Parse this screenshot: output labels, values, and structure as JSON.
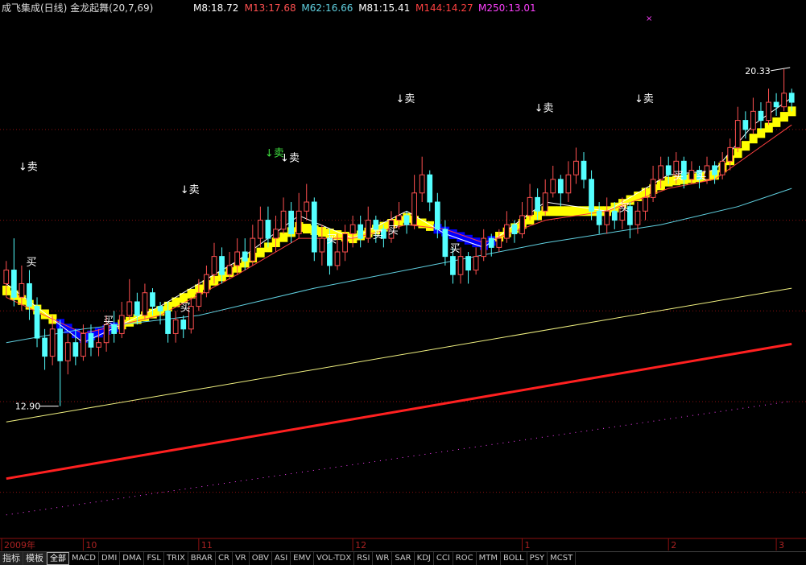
{
  "header": {
    "title": "成飞集成(日线) 金龙起舞(20,7,69)",
    "title_color": "#dddddd",
    "ma_labels": [
      {
        "text": "M8:18.72",
        "color": "#ffffff"
      },
      {
        "text": "M13:17.68",
        "color": "#ff5050"
      },
      {
        "text": "M62:16.66",
        "color": "#60d0e0"
      },
      {
        "text": "M81:15.41",
        "color": "#ffffff"
      },
      {
        "text": "M144:14.27",
        "color": "#ff4040"
      },
      {
        "text": "M250:13.01",
        "color": "#ff40ff"
      }
    ]
  },
  "chart_data": {
    "type": "candlestick",
    "x_labels": [
      {
        "text": "2009年",
        "index": 0
      },
      {
        "text": "10",
        "index": 10
      },
      {
        "text": "11",
        "index": 25
      },
      {
        "text": "12",
        "index": 45
      },
      {
        "text": "1",
        "index": 67
      },
      {
        "text": "2",
        "index": 86
      },
      {
        "text": "3",
        "index": 100
      }
    ],
    "ylim": [
      10.0,
      21.5
    ],
    "gridlines": [
      11.0,
      13.0,
      15.0,
      17.0,
      19.0
    ],
    "annotations": {
      "high": {
        "text": "20.33",
        "index": 102,
        "value": 20.33
      },
      "low": {
        "text": "12.90",
        "index": 7,
        "value": 12.9
      }
    },
    "candles": [
      [
        15.6,
        15.9,
        16.1,
        15.3
      ],
      [
        15.9,
        15.3,
        16.6,
        15.1
      ],
      [
        15.3,
        15.6,
        16.0,
        15.0
      ],
      [
        15.6,
        15.1,
        15.9,
        14.8
      ],
      [
        15.1,
        14.4,
        15.3,
        14.2
      ],
      [
        14.4,
        14.0,
        14.6,
        13.7
      ],
      [
        14.0,
        14.6,
        14.9,
        13.8
      ],
      [
        14.6,
        13.9,
        14.8,
        12.9
      ],
      [
        13.9,
        14.3,
        14.5,
        13.6
      ],
      [
        14.3,
        14.0,
        14.6,
        13.8
      ],
      [
        14.0,
        14.5,
        14.7,
        13.9
      ],
      [
        14.5,
        14.2,
        14.7,
        14.0
      ],
      [
        14.2,
        14.3,
        14.6,
        14.0
      ],
      [
        14.3,
        14.7,
        14.9,
        14.1
      ],
      [
        14.7,
        14.5,
        15.0,
        14.3
      ],
      [
        14.5,
        14.9,
        15.2,
        14.4
      ],
      [
        14.9,
        15.2,
        15.7,
        14.8
      ],
      [
        15.2,
        14.9,
        15.4,
        14.7
      ],
      [
        14.9,
        15.4,
        15.6,
        14.8
      ],
      [
        15.4,
        15.1,
        15.5,
        14.9
      ],
      [
        15.1,
        15.0,
        15.2,
        14.7
      ],
      [
        15.0,
        14.5,
        15.2,
        14.3
      ],
      [
        14.5,
        14.8,
        15.0,
        14.3
      ],
      [
        14.8,
        14.6,
        14.9,
        14.4
      ],
      [
        14.6,
        15.1,
        15.3,
        14.5
      ],
      [
        15.1,
        15.4,
        15.7,
        15.0
      ],
      [
        15.4,
        15.8,
        16.0,
        15.3
      ],
      [
        15.8,
        16.2,
        16.5,
        15.6
      ],
      [
        16.2,
        15.8,
        16.4,
        15.6
      ],
      [
        15.8,
        16.0,
        16.3,
        15.7
      ],
      [
        16.0,
        16.3,
        16.6,
        15.8
      ],
      [
        16.3,
        16.1,
        16.6,
        15.9
      ],
      [
        16.1,
        16.6,
        16.9,
        16.0
      ],
      [
        16.6,
        17.0,
        17.3,
        16.4
      ],
      [
        17.0,
        16.6,
        17.3,
        16.4
      ],
      [
        16.6,
        16.8,
        17.1,
        16.3
      ],
      [
        16.8,
        17.2,
        17.5,
        16.7
      ],
      [
        17.2,
        16.7,
        17.4,
        16.5
      ],
      [
        16.7,
        17.2,
        17.6,
        16.6
      ],
      [
        17.2,
        17.4,
        17.8,
        17.0
      ],
      [
        17.4,
        16.3,
        17.5,
        16.1
      ],
      [
        16.3,
        16.6,
        16.9,
        16.0
      ],
      [
        16.6,
        16.0,
        16.8,
        15.8
      ],
      [
        16.0,
        16.3,
        16.7,
        15.9
      ],
      [
        16.3,
        16.7,
        16.9,
        16.1
      ],
      [
        16.7,
        16.9,
        17.1,
        16.4
      ],
      [
        16.9,
        16.6,
        17.1,
        16.4
      ],
      [
        16.6,
        17.0,
        17.3,
        16.5
      ],
      [
        17.0,
        16.8,
        17.1,
        16.5
      ],
      [
        16.8,
        16.6,
        16.9,
        16.4
      ],
      [
        16.6,
        17.0,
        17.2,
        16.5
      ],
      [
        17.0,
        17.1,
        17.4,
        16.8
      ],
      [
        17.1,
        16.9,
        17.2,
        16.7
      ],
      [
        16.9,
        17.6,
        18.0,
        16.8
      ],
      [
        17.6,
        18.0,
        18.4,
        17.4
      ],
      [
        18.0,
        17.4,
        18.1,
        17.2
      ],
      [
        17.4,
        16.8,
        17.6,
        16.6
      ],
      [
        16.8,
        16.2,
        17.0,
        16.0
      ],
      [
        16.2,
        15.8,
        16.4,
        15.6
      ],
      [
        15.8,
        16.2,
        16.4,
        15.6
      ],
      [
        16.2,
        15.9,
        16.3,
        15.6
      ],
      [
        15.9,
        16.2,
        16.4,
        15.8
      ],
      [
        16.2,
        16.6,
        16.8,
        16.1
      ],
      [
        16.6,
        16.4,
        16.7,
        16.2
      ],
      [
        16.4,
        16.6,
        16.8,
        16.3
      ],
      [
        16.6,
        16.9,
        17.2,
        16.5
      ],
      [
        16.9,
        16.7,
        17.0,
        16.5
      ],
      [
        16.7,
        17.1,
        17.4,
        16.6
      ],
      [
        17.1,
        17.5,
        17.8,
        17.0
      ],
      [
        17.5,
        17.2,
        17.7,
        17.0
      ],
      [
        17.2,
        17.6,
        17.9,
        17.1
      ],
      [
        17.6,
        17.9,
        18.2,
        17.5
      ],
      [
        17.9,
        17.6,
        18.0,
        17.3
      ],
      [
        17.6,
        18.0,
        18.3,
        17.4
      ],
      [
        18.0,
        18.3,
        18.6,
        17.8
      ],
      [
        18.3,
        17.9,
        18.5,
        17.7
      ],
      [
        17.9,
        17.2,
        18.1,
        17.0
      ],
      [
        17.2,
        16.9,
        17.4,
        16.7
      ],
      [
        16.9,
        17.2,
        17.5,
        16.7
      ],
      [
        17.2,
        17.0,
        17.4,
        16.8
      ],
      [
        17.0,
        17.3,
        17.5,
        16.8
      ],
      [
        17.3,
        16.9,
        17.4,
        16.6
      ],
      [
        16.9,
        17.2,
        17.4,
        16.7
      ],
      [
        17.2,
        17.5,
        17.7,
        17.0
      ],
      [
        17.5,
        17.9,
        18.2,
        17.4
      ],
      [
        17.9,
        18.2,
        18.4,
        17.7
      ],
      [
        18.2,
        18.0,
        18.4,
        17.8
      ],
      [
        18.0,
        18.3,
        18.5,
        17.8
      ],
      [
        18.3,
        17.9,
        18.4,
        17.7
      ],
      [
        17.9,
        18.1,
        18.3,
        17.8
      ],
      [
        18.1,
        17.9,
        18.2,
        17.7
      ],
      [
        17.9,
        18.2,
        18.4,
        17.8
      ],
      [
        18.2,
        18.0,
        18.3,
        17.8
      ],
      [
        18.0,
        18.3,
        18.5,
        17.9
      ],
      [
        18.3,
        18.6,
        18.8,
        18.1
      ],
      [
        18.6,
        19.2,
        19.5,
        18.5
      ],
      [
        19.2,
        19.0,
        19.4,
        18.8
      ],
      [
        19.0,
        19.4,
        19.7,
        18.9
      ],
      [
        19.4,
        19.2,
        19.6,
        19.0
      ],
      [
        19.2,
        19.6,
        19.9,
        19.1
      ],
      [
        19.6,
        19.5,
        19.8,
        19.3
      ],
      [
        19.5,
        19.8,
        20.33,
        19.4
      ],
      [
        19.8,
        19.6,
        19.9,
        19.4
      ]
    ],
    "signals": [
      {
        "text": "↓卖",
        "index": 2,
        "value": 18.1,
        "color": "#ffffff"
      },
      {
        "text": "↓卖",
        "index": 23,
        "value": 17.6,
        "color": "#ffffff"
      },
      {
        "text": "↓卖",
        "index": 34,
        "value": 18.4,
        "color": "#40e040"
      },
      {
        "text": "↓卖",
        "index": 36,
        "value": 18.3,
        "color": "#ffffff"
      },
      {
        "text": "↓卖",
        "index": 51,
        "value": 19.6,
        "color": "#ffffff"
      },
      {
        "text": "↓卖",
        "index": 69,
        "value": 19.4,
        "color": "#ffffff"
      },
      {
        "text": "↓卖",
        "index": 82,
        "value": 19.6,
        "color": "#ffffff"
      },
      {
        "text": "买",
        "index": 3,
        "value": 16.0,
        "color": "#ffffff"
      },
      {
        "text": "买",
        "index": 13,
        "value": 14.7,
        "color": "#ffffff"
      },
      {
        "text": "买",
        "index": 23,
        "value": 15.0,
        "color": "#ffffff"
      },
      {
        "text": "买",
        "index": 42,
        "value": 16.5,
        "color": "#ffffff"
      },
      {
        "text": "买",
        "index": 48,
        "value": 16.6,
        "color": "#ffffff"
      },
      {
        "text": "买",
        "index": 50,
        "value": 16.7,
        "color": "#ffffff"
      },
      {
        "text": "买",
        "index": 58,
        "value": 16.3,
        "color": "#ffffff"
      },
      {
        "text": "买",
        "index": 80,
        "value": 17.2,
        "color": "#ffffff"
      },
      {
        "text": "买",
        "index": 87,
        "value": 17.9,
        "color": "#ffffff"
      },
      {
        "text": "买",
        "index": 90,
        "value": 17.9,
        "color": "#ffffff"
      }
    ],
    "lines": [
      {
        "name": "M8",
        "color": "#ffffff",
        "points": [
          [
            0,
            15.6
          ],
          [
            10,
            14.3
          ],
          [
            20,
            15.1
          ],
          [
            30,
            16.1
          ],
          [
            38,
            17.1
          ],
          [
            45,
            16.6
          ],
          [
            52,
            17.2
          ],
          [
            57,
            16.7
          ],
          [
            62,
            16.4
          ],
          [
            70,
            17.4
          ],
          [
            78,
            17.2
          ],
          [
            86,
            18.0
          ],
          [
            92,
            18.1
          ],
          [
            97,
            19.1
          ],
          [
            102,
            19.7
          ]
        ]
      },
      {
        "name": "M13",
        "color": "#ff4040",
        "points": [
          [
            0,
            15.3
          ],
          [
            10,
            14.5
          ],
          [
            20,
            14.9
          ],
          [
            30,
            15.8
          ],
          [
            38,
            16.6
          ],
          [
            45,
            16.6
          ],
          [
            52,
            16.9
          ],
          [
            57,
            16.8
          ],
          [
            62,
            16.5
          ],
          [
            70,
            17.0
          ],
          [
            78,
            17.2
          ],
          [
            86,
            17.7
          ],
          [
            92,
            17.9
          ],
          [
            97,
            18.5
          ],
          [
            102,
            19.1
          ]
        ]
      },
      {
        "name": "M62",
        "color": "#60d0e0",
        "points": [
          [
            0,
            14.3
          ],
          [
            10,
            14.6
          ],
          [
            25,
            14.9
          ],
          [
            40,
            15.5
          ],
          [
            55,
            16.0
          ],
          [
            70,
            16.5
          ],
          [
            85,
            16.9
          ],
          [
            95,
            17.3
          ],
          [
            102,
            17.7
          ]
        ]
      },
      {
        "name": "M81",
        "color": "#f0f080",
        "points": [
          [
            0,
            12.55
          ],
          [
            102,
            15.5
          ]
        ]
      },
      {
        "name": "M144",
        "color": "#ff2020",
        "width": 3,
        "points": [
          [
            0,
            11.3
          ],
          [
            102,
            14.27
          ]
        ]
      },
      {
        "name": "M250",
        "color": "#ff40ff",
        "dotted": true,
        "points": [
          [
            0,
            10.5
          ],
          [
            102,
            13.01
          ]
        ]
      }
    ],
    "band_fill_colors": {
      "up": "#ffff00",
      "down": "#0000ff"
    },
    "candle_colors": {
      "up": "#ff5050",
      "down": "#54ffff"
    }
  },
  "tabs": [
    {
      "label": "指标",
      "lead": true
    },
    {
      "label": "模板",
      "lead": true
    },
    {
      "label": "全部",
      "active": true
    },
    {
      "label": "MACD"
    },
    {
      "label": "DMI"
    },
    {
      "label": "DMA"
    },
    {
      "label": "FSL"
    },
    {
      "label": "TRIX"
    },
    {
      "label": "BRAR"
    },
    {
      "label": "CR"
    },
    {
      "label": "VR"
    },
    {
      "label": "OBV"
    },
    {
      "label": "ASI"
    },
    {
      "label": "EMV"
    },
    {
      "label": "VOL-TDX"
    },
    {
      "label": "RSI"
    },
    {
      "label": "WR"
    },
    {
      "label": "SAR"
    },
    {
      "label": "KDJ"
    },
    {
      "label": "CCI"
    },
    {
      "label": "ROC"
    },
    {
      "label": "MTM"
    },
    {
      "label": "BOLL"
    },
    {
      "label": "PSY"
    },
    {
      "label": "MCST"
    }
  ]
}
